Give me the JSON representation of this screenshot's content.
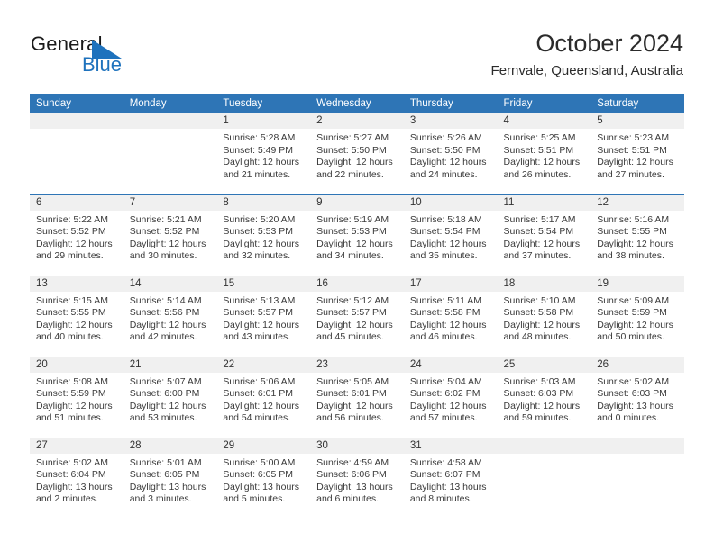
{
  "brand": {
    "name_top": "General",
    "name_bottom": "Blue",
    "triangle_color": "#1e72bd",
    "text_color": "#1a1a1a"
  },
  "header": {
    "title": "October 2024",
    "subtitle": "Fernvale, Queensland, Australia"
  },
  "theme": {
    "header_blue": "#2e75b6",
    "daynum_band": "#f0f0f0",
    "body_text": "#3a3a3a"
  },
  "weekdays": [
    "Sunday",
    "Monday",
    "Tuesday",
    "Wednesday",
    "Thursday",
    "Friday",
    "Saturday"
  ],
  "weeks": [
    [
      {
        "day": "",
        "empty": true
      },
      {
        "day": "",
        "empty": true
      },
      {
        "day": "1",
        "sunrise": "Sunrise: 5:28 AM",
        "sunset": "Sunset: 5:49 PM",
        "daylight": "Daylight: 12 hours and 21 minutes."
      },
      {
        "day": "2",
        "sunrise": "Sunrise: 5:27 AM",
        "sunset": "Sunset: 5:50 PM",
        "daylight": "Daylight: 12 hours and 22 minutes."
      },
      {
        "day": "3",
        "sunrise": "Sunrise: 5:26 AM",
        "sunset": "Sunset: 5:50 PM",
        "daylight": "Daylight: 12 hours and 24 minutes."
      },
      {
        "day": "4",
        "sunrise": "Sunrise: 5:25 AM",
        "sunset": "Sunset: 5:51 PM",
        "daylight": "Daylight: 12 hours and 26 minutes."
      },
      {
        "day": "5",
        "sunrise": "Sunrise: 5:23 AM",
        "sunset": "Sunset: 5:51 PM",
        "daylight": "Daylight: 12 hours and 27 minutes."
      }
    ],
    [
      {
        "day": "6",
        "sunrise": "Sunrise: 5:22 AM",
        "sunset": "Sunset: 5:52 PM",
        "daylight": "Daylight: 12 hours and 29 minutes."
      },
      {
        "day": "7",
        "sunrise": "Sunrise: 5:21 AM",
        "sunset": "Sunset: 5:52 PM",
        "daylight": "Daylight: 12 hours and 30 minutes."
      },
      {
        "day": "8",
        "sunrise": "Sunrise: 5:20 AM",
        "sunset": "Sunset: 5:53 PM",
        "daylight": "Daylight: 12 hours and 32 minutes."
      },
      {
        "day": "9",
        "sunrise": "Sunrise: 5:19 AM",
        "sunset": "Sunset: 5:53 PM",
        "daylight": "Daylight: 12 hours and 34 minutes."
      },
      {
        "day": "10",
        "sunrise": "Sunrise: 5:18 AM",
        "sunset": "Sunset: 5:54 PM",
        "daylight": "Daylight: 12 hours and 35 minutes."
      },
      {
        "day": "11",
        "sunrise": "Sunrise: 5:17 AM",
        "sunset": "Sunset: 5:54 PM",
        "daylight": "Daylight: 12 hours and 37 minutes."
      },
      {
        "day": "12",
        "sunrise": "Sunrise: 5:16 AM",
        "sunset": "Sunset: 5:55 PM",
        "daylight": "Daylight: 12 hours and 38 minutes."
      }
    ],
    [
      {
        "day": "13",
        "sunrise": "Sunrise: 5:15 AM",
        "sunset": "Sunset: 5:55 PM",
        "daylight": "Daylight: 12 hours and 40 minutes."
      },
      {
        "day": "14",
        "sunrise": "Sunrise: 5:14 AM",
        "sunset": "Sunset: 5:56 PM",
        "daylight": "Daylight: 12 hours and 42 minutes."
      },
      {
        "day": "15",
        "sunrise": "Sunrise: 5:13 AM",
        "sunset": "Sunset: 5:57 PM",
        "daylight": "Daylight: 12 hours and 43 minutes."
      },
      {
        "day": "16",
        "sunrise": "Sunrise: 5:12 AM",
        "sunset": "Sunset: 5:57 PM",
        "daylight": "Daylight: 12 hours and 45 minutes."
      },
      {
        "day": "17",
        "sunrise": "Sunrise: 5:11 AM",
        "sunset": "Sunset: 5:58 PM",
        "daylight": "Daylight: 12 hours and 46 minutes."
      },
      {
        "day": "18",
        "sunrise": "Sunrise: 5:10 AM",
        "sunset": "Sunset: 5:58 PM",
        "daylight": "Daylight: 12 hours and 48 minutes."
      },
      {
        "day": "19",
        "sunrise": "Sunrise: 5:09 AM",
        "sunset": "Sunset: 5:59 PM",
        "daylight": "Daylight: 12 hours and 50 minutes."
      }
    ],
    [
      {
        "day": "20",
        "sunrise": "Sunrise: 5:08 AM",
        "sunset": "Sunset: 5:59 PM",
        "daylight": "Daylight: 12 hours and 51 minutes."
      },
      {
        "day": "21",
        "sunrise": "Sunrise: 5:07 AM",
        "sunset": "Sunset: 6:00 PM",
        "daylight": "Daylight: 12 hours and 53 minutes."
      },
      {
        "day": "22",
        "sunrise": "Sunrise: 5:06 AM",
        "sunset": "Sunset: 6:01 PM",
        "daylight": "Daylight: 12 hours and 54 minutes."
      },
      {
        "day": "23",
        "sunrise": "Sunrise: 5:05 AM",
        "sunset": "Sunset: 6:01 PM",
        "daylight": "Daylight: 12 hours and 56 minutes."
      },
      {
        "day": "24",
        "sunrise": "Sunrise: 5:04 AM",
        "sunset": "Sunset: 6:02 PM",
        "daylight": "Daylight: 12 hours and 57 minutes."
      },
      {
        "day": "25",
        "sunrise": "Sunrise: 5:03 AM",
        "sunset": "Sunset: 6:03 PM",
        "daylight": "Daylight: 12 hours and 59 minutes."
      },
      {
        "day": "26",
        "sunrise": "Sunrise: 5:02 AM",
        "sunset": "Sunset: 6:03 PM",
        "daylight": "Daylight: 13 hours and 0 minutes."
      }
    ],
    [
      {
        "day": "27",
        "sunrise": "Sunrise: 5:02 AM",
        "sunset": "Sunset: 6:04 PM",
        "daylight": "Daylight: 13 hours and 2 minutes."
      },
      {
        "day": "28",
        "sunrise": "Sunrise: 5:01 AM",
        "sunset": "Sunset: 6:05 PM",
        "daylight": "Daylight: 13 hours and 3 minutes."
      },
      {
        "day": "29",
        "sunrise": "Sunrise: 5:00 AM",
        "sunset": "Sunset: 6:05 PM",
        "daylight": "Daylight: 13 hours and 5 minutes."
      },
      {
        "day": "30",
        "sunrise": "Sunrise: 4:59 AM",
        "sunset": "Sunset: 6:06 PM",
        "daylight": "Daylight: 13 hours and 6 minutes."
      },
      {
        "day": "31",
        "sunrise": "Sunrise: 4:58 AM",
        "sunset": "Sunset: 6:07 PM",
        "daylight": "Daylight: 13 hours and 8 minutes."
      },
      {
        "day": "",
        "empty": true
      },
      {
        "day": "",
        "empty": true
      }
    ]
  ]
}
